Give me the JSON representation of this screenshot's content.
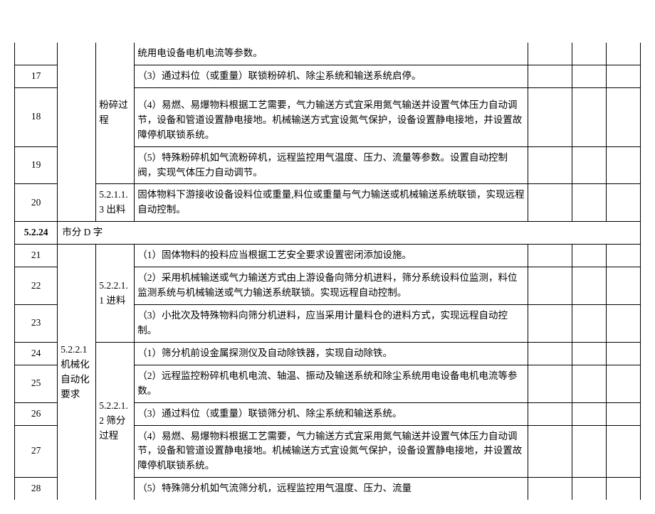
{
  "r1_c2": "",
  "r1_c3": "粉碎过程",
  "r1_c4": "统用电设备电机电流等参数。",
  "r2_c1": "17",
  "r2_c4": "（3）通过料位（或重量）联锁粉碎机、除尘系统和输送系统启停。",
  "r3_c1": "18",
  "r3_c4": "（4）易燃、易爆物料根据工艺需要，气力输送方式宜采用氮气输送并设置气体压力自动调节，设备和管道设置静电接地。机械输送方式宜设氮气保护，设备设置静电接地，并设置故障停机联锁系统。",
  "r4_c1": "19",
  "r4_c4": "（5）特殊粉碎机如气流粉碎机，远程监控用气温度、压力、流量等参数。设置自动控制阀，实现气体压力自动调节。",
  "r5_c1": "20",
  "r5_c3": "5.2.1.1.3 出料",
  "r5_c4": "固体物料下游接收设备设料位或重量,料位或重量与气力输送或机械输送系统联锁，实现远程自动控制。",
  "section_label": "5.2.24",
  "section_text": "市分 D 字",
  "r6_c1": "21",
  "r6_c2": "5.2.2.1 机械化自动化要求",
  "r6_c3a": "5.2.2.1.1 进料",
  "r6_c4": "（1）固体物料的投料应当根据工艺安全要求设置密闭添加设施。",
  "r7_c1": "22",
  "r7_c4": "（2）采用机械输送或气力输送方式由上游设备向筛分机进料，筛分系统设料位监测，料位监测系统与机械输送或气力输送系统联锁。实现远程自动控制。",
  "r8_c1": "23",
  "r8_c4": "（3）小批次及特殊物料向筛分机进料，应当采用计量料仓的进料方式，实现远程自动控制。",
  "r9_c1": "24",
  "r9_c3b": "5.2.2.1.2 筛分过程",
  "r9_c4": "（1）筛分机前设金属探测仪及自动除铁器，实现自动除铁。",
  "r10_c1": "25",
  "r10_c4": "（2）远程监控粉碎机电机电流、轴温、振动及输送系统和除尘系统用电设备电机电流等参数。",
  "r11_c1": "26",
  "r11_c4": "（3）通过料位（或重量）联锁筛分机、除尘系统和输送系统。",
  "r12_c1": "27",
  "r12_c4": "（4）易燃、易爆物料根据工艺需要，气力输送方式宜采用氮气输送并设置气体压力自动调节，设备和管道设置静电接地。机械输送方式宜设氮气保护，设备设置静电接地，并设置故障停机联锁系统。",
  "r13_c1": "28",
  "r13_c4": "（5）特殊筛分机如气流筛分机，远程监控用气温度、压力、流量"
}
